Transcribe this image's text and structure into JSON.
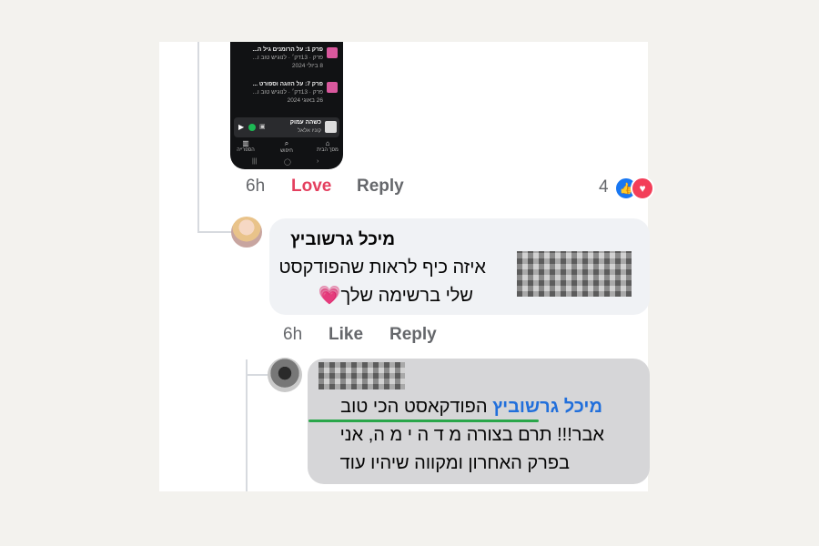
{
  "phone": {
    "episodes": [
      {
        "title": "פרק 1: על הרומנים גיל ה...",
        "meta": "פרק · 13דק׳ · לנוגיש טוב ו...",
        "date": "8 ביולי 2024"
      },
      {
        "title": "פרק 7: על הזוגה וספורט ...",
        "meta": "פרק · 13דק׳ · לנוגיש טוב ו...",
        "date": "26 באוגי 2024"
      }
    ],
    "player": {
      "title": "כשהה עמוק",
      "subtitle": "קוניו אלאל"
    },
    "nav": [
      {
        "icon": "home-icon",
        "label": "מסך הבית"
      },
      {
        "icon": "search-icon",
        "label": "חיפוש"
      },
      {
        "icon": "library-icon",
        "label": "הספרייה"
      }
    ],
    "sysbar": [
      "|||",
      "◯",
      "‹"
    ]
  },
  "post_actions": {
    "time": "6h",
    "reaction": "Love",
    "reply": "Reply",
    "reaction_count": "4"
  },
  "comment1": {
    "author": "מיכל גרשוביץ",
    "text_line1": "איזה כיף לראות שהפודקסט",
    "text_line2": "שלי ברשימה שלך💗",
    "time": "6h",
    "like": "Like",
    "reply": "Reply"
  },
  "comment2": {
    "mention": "מיכל גרשוביץ",
    "line1_rest": " הפודקאסט הכי טוב",
    "line2": "אבר!!! תרם בצורה מ ד ה י מ ה, אני",
    "line3": "בפרק האחרון ומקווה שיהיו עוד"
  },
  "colors": {
    "love": "#e4405f",
    "mention": "#216fdb",
    "underline": "#2aa64a",
    "meta": "#65676b",
    "bubble1": "#f0f2f5",
    "bubble2": "#d6d6d8"
  }
}
